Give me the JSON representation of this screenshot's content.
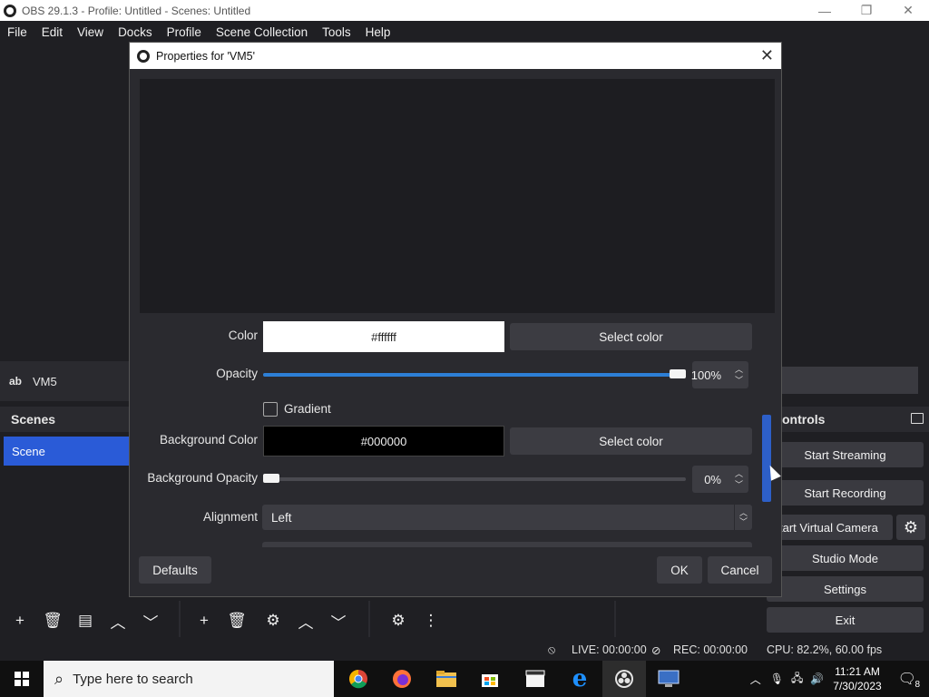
{
  "window": {
    "title": "OBS 29.1.3 - Profile: Untitled - Scenes: Untitled",
    "minimize": "—",
    "maximize": "❐",
    "close": "✕"
  },
  "menu": [
    "File",
    "Edit",
    "View",
    "Docks",
    "Profile",
    "Scene Collection",
    "Tools",
    "Help"
  ],
  "source": {
    "type_glyph": "ab",
    "name": "VM5"
  },
  "scenes": {
    "header": "Scenes",
    "items": [
      "Scene"
    ]
  },
  "controls": {
    "header": "ontrols",
    "start_streaming": "Start Streaming",
    "start_recording": "Start Recording",
    "start_virtual_camera": "tart Virtual Camerа",
    "studio_mode": "Studio Mode",
    "settings": "Settings",
    "exit": "Exit"
  },
  "status": {
    "live": "LIVE: 00:00:00",
    "rec": "REC: 00:00:00",
    "cpu": "CPU: 82.2%, 60.00 fps"
  },
  "dialog": {
    "title": "Properties for 'VM5'",
    "color_label": "Color",
    "color_value": "#ffffff",
    "select_color": "Select color",
    "opacity_label": "Opacity",
    "opacity_value": "100%",
    "opacity_level": 1.0,
    "gradient_label": "Gradient",
    "gradient_checked": false,
    "bg_color_label": "Background Color",
    "bg_color_value": "#000000",
    "bg_opacity_label": "Background Opacity",
    "bg_opacity_value": "0%",
    "bg_opacity_level": 0.0,
    "alignment_label": "Alignment",
    "alignment_value": "Left",
    "defaults": "Defaults",
    "ok": "OK",
    "cancel": "Cancel"
  },
  "taskbar": {
    "search_placeholder": "Type here to search",
    "time": "11:21 AM",
    "date": "7/30/2023",
    "notifications": "8"
  },
  "colors": {
    "accent": "#2a5bd7",
    "slider": "#2d7fd6",
    "dialog_bg": "#2a2a2f",
    "app_bg": "#1f1f23"
  }
}
